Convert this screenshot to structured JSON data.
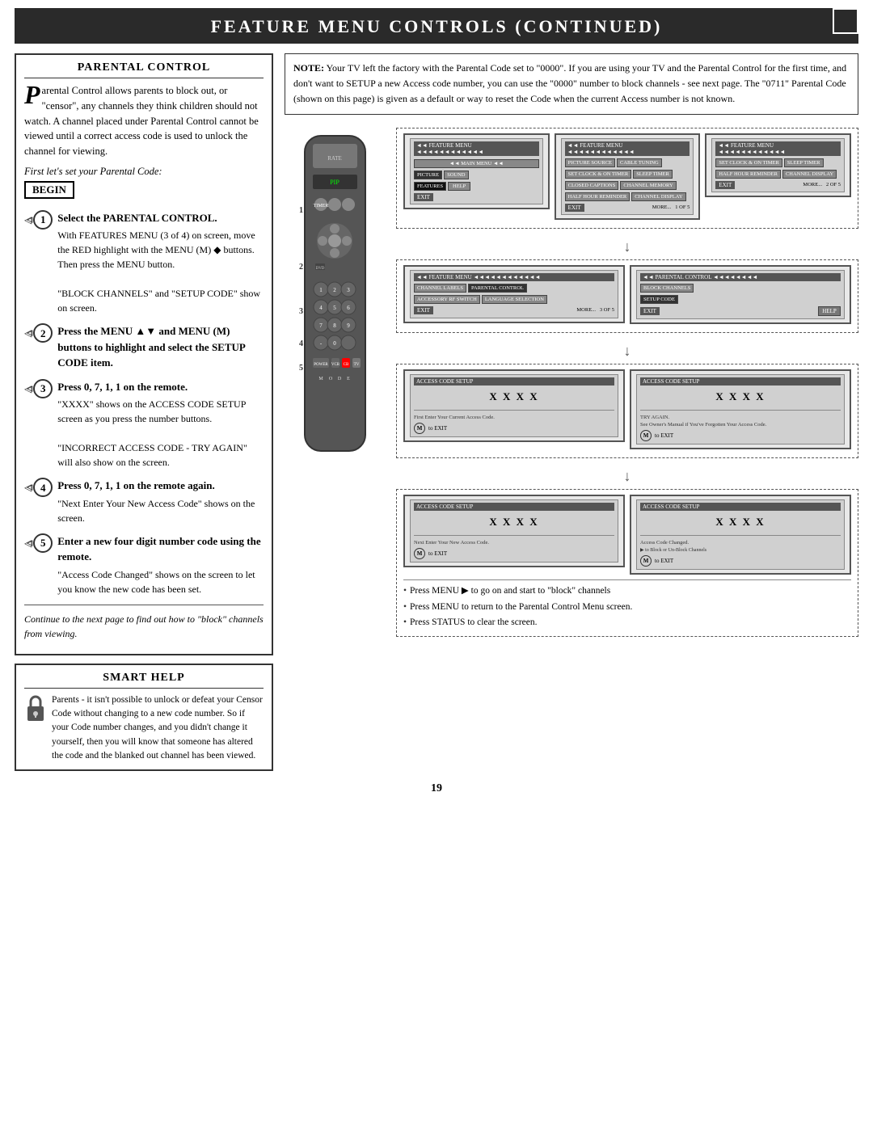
{
  "header": {
    "title": "Feature Menu Controls (Continued)"
  },
  "note": {
    "label": "NOTE:",
    "text": "Your TV left the factory with the Parental Code set to \"0000\". If you are using your TV and the Parental Control for the first time, and don't want to SETUP a new Access code number, you can use the \"0000\" number to block channels - see next page. The \"0711\" Parental Code (shown on this page) is given as a default or way to reset the Code when the current Access number is not known."
  },
  "parental_box": {
    "title": "PARENTAL CONTROL",
    "intro": "arental Control allows parents to block out, or \"censor\", any channels they think children should not watch. A channel placed under Parental Control cannot be viewed until a correct access code is used to unlock the channel for viewing.",
    "first_set": "First let's set your Parental Code:",
    "begin": "BEGIN",
    "steps": [
      {
        "num": "1",
        "title": "Select the PARENTAL CONTROL.",
        "details": "With FEATURES MENU (3 of 4) on screen, move the RED highlight with the MENU (M) ◆ buttons.\nThen press the MENU button.\n\n\"BLOCK CHANNELS\" and \"SETUP CODE\" show on screen."
      },
      {
        "num": "2",
        "title": "Press the MENU ▲▼ and MENU (M) buttons",
        "details": "to highlight and select the SETUP CODE item."
      },
      {
        "num": "3",
        "title": "Press 0, 7, 1, 1 on the remote.",
        "details": "\"XXXX\" shows on the ACCESS CODE SETUP screen as you press the number buttons.\n\n\"INCORRECT ACCESS CODE - TRY AGAIN\" will also show on the screen."
      },
      {
        "num": "4",
        "title": "Press 0, 7, 1, 1 on the remote again.",
        "details": "\"Next Enter Your New Access Code\" shows on the screen."
      },
      {
        "num": "5",
        "title": "Enter a new four digit number code using the remote.",
        "details": "\"Access Code Changed\" shows on the screen to let you know the new code has been set."
      }
    ],
    "continue_text": "Continue to the next page to find out how to \"block\" channels from viewing."
  },
  "smart_help": {
    "title": "Smart Help",
    "text": "Parents - it isn't possible to unlock or defeat your Censor Code without changing to a new code number. So if your Code number changes, and you didn't change it yourself, then you will know that someone has altered the code and the blanked out channel has been viewed."
  },
  "diagrams": {
    "row1": {
      "screen1_label": "◄◄ FEATURE MENU ◄◄◄◄◄◄◄◄◄◄",
      "screen1_items": [
        "PICTURE SOURCE",
        "CABLE TUNING",
        "SET CLOCK & ON TIMER",
        "SLEEP TIMER"
      ],
      "screen1_row2": [
        "CLOSED CAPTIONS",
        "CHANNEL MEMORY",
        "HALF HOUR REMINDER",
        "CHANNEL DISPLAY"
      ],
      "screen1_exit": "EXIT",
      "screen1_more": "MORE...",
      "screen1_page": "1 OF 5",
      "screen2_label": "◄◄ FEATURE MENU ◄◄◄◄◄◄◄◄◄◄",
      "screen2_items": [
        "SET CLOCK & ON TIMER",
        "SLEEP TIMER"
      ],
      "screen2_row2": [
        "HALF HOUR REMINDER",
        "CHANNEL DISPLAY"
      ],
      "screen2_exit": "EXIT",
      "screen2_more": "MORE...",
      "screen2_page": "2 OF 5"
    },
    "row2": {
      "screen1_label": "◄◄ FEATURE MENU ◄◄◄◄◄◄◄◄◄◄",
      "screen1_items": [
        "CHANNEL LABELS",
        "PARENTAL CONTROL"
      ],
      "screen1_row2": [
        "ACCESSORY RF SWITCH",
        "LANGUAGE SELECTION"
      ],
      "screen1_exit": "EXIT",
      "screen1_more": "MORE...",
      "screen1_page": "3 OF 5",
      "screen2_label": "◄◄ PARENTAL CONTROL ◄◄◄◄◄◄◄",
      "screen2_items": [
        "BLOCK CHANNELS"
      ],
      "screen2_row2": [
        "SETUP CODE"
      ],
      "screen2_exit": "EXIT",
      "screen2_help": "HELP"
    },
    "row3": {
      "screen1_label": "ACCESS CODE SETUP",
      "screen1_xxxx": "X X X X",
      "screen1_text1": "First Enter Your Current Access Code.",
      "screen1_m": "M",
      "screen1_exit": "to EXIT",
      "screen2_label": "ACCESS CODE SETUP",
      "screen2_xxxx": "X X X X",
      "screen2_text1": "TRY AGAIN. See Owner's Manual if You've Forgotten Your Access Code.",
      "screen2_m": "M",
      "screen2_exit": "to EXIT"
    },
    "row4": {
      "screen1_label": "ACCESS CODE SETUP",
      "screen1_xxxx": "X X X X",
      "screen1_text1": "Next Enter Your New Access Code.",
      "screen1_m": "M",
      "screen1_exit": "to EXIT",
      "screen2_label": "ACCESS CODE SETUP",
      "screen2_xxxx": "X X X X",
      "screen2_text1": "Access Code Changed.",
      "screen2_text2": "▶ to Block or Un-Block Channels",
      "screen2_m": "M",
      "screen2_exit": "to EXIT"
    }
  },
  "bullets": [
    "Press MENU ▶ to go on and start to \"block\" channels",
    "Press MENU to return to the Parental Control Menu screen.",
    "Press STATUS to clear the screen."
  ],
  "page_number": "19"
}
